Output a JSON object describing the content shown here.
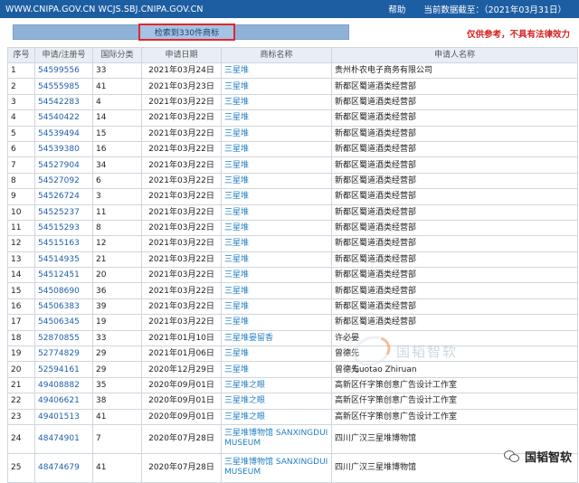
{
  "header": {
    "site": "WWW.CNIPA.GOV.CN WCJS.SBJ.CNIPA.GOV.CN",
    "help": "帮助",
    "date": "当前数据截至：（2021年03月31日）"
  },
  "toolbar": {
    "result": "检索到330件商标",
    "disclaimer": "仅供参考，不具有法律效力"
  },
  "columns": [
    "序号",
    "申请/注册号",
    "国际分类",
    "申请日期",
    "商标名称",
    "申请人名称"
  ],
  "rows": [
    {
      "idx": "1",
      "num": "54599556",
      "cls": "33",
      "date": "2021年03月24日",
      "mark": "三星堆",
      "applicant": "贵州朴农电子商务有限公司"
    },
    {
      "idx": "2",
      "num": "54555985",
      "cls": "41",
      "date": "2021年03月23日",
      "mark": "三星堆",
      "applicant": "新都区蜀道酒类经营部"
    },
    {
      "idx": "3",
      "num": "54542283",
      "cls": "4",
      "date": "2021年03月22日",
      "mark": "三星堆",
      "applicant": "新都区蜀道酒类经营部"
    },
    {
      "idx": "4",
      "num": "54540422",
      "cls": "14",
      "date": "2021年03月22日",
      "mark": "三星堆",
      "applicant": "新都区蜀道酒类经营部"
    },
    {
      "idx": "5",
      "num": "54539494",
      "cls": "15",
      "date": "2021年03月22日",
      "mark": "三星堆",
      "applicant": "新都区蜀道酒类经营部"
    },
    {
      "idx": "6",
      "num": "54539380",
      "cls": "16",
      "date": "2021年03月22日",
      "mark": "三星堆",
      "applicant": "新都区蜀道酒类经营部"
    },
    {
      "idx": "7",
      "num": "54527904",
      "cls": "34",
      "date": "2021年03月22日",
      "mark": "三星堆",
      "applicant": "新都区蜀道酒类经营部"
    },
    {
      "idx": "8",
      "num": "54527092",
      "cls": "6",
      "date": "2021年03月22日",
      "mark": "三星堆",
      "applicant": "新都区蜀道酒类经营部"
    },
    {
      "idx": "9",
      "num": "54526724",
      "cls": "3",
      "date": "2021年03月22日",
      "mark": "三星堆",
      "applicant": "新都区蜀道酒类经营部"
    },
    {
      "idx": "10",
      "num": "54525237",
      "cls": "11",
      "date": "2021年03月22日",
      "mark": "三星堆",
      "applicant": "新都区蜀道酒类经营部"
    },
    {
      "idx": "11",
      "num": "54515293",
      "cls": "8",
      "date": "2021年03月22日",
      "mark": "三星堆",
      "applicant": "新都区蜀道酒类经营部"
    },
    {
      "idx": "12",
      "num": "54515163",
      "cls": "12",
      "date": "2021年03月22日",
      "mark": "三星堆",
      "applicant": "新都区蜀道酒类经营部"
    },
    {
      "idx": "13",
      "num": "54514935",
      "cls": "21",
      "date": "2021年03月22日",
      "mark": "三星堆",
      "applicant": "新都区蜀道酒类经营部"
    },
    {
      "idx": "14",
      "num": "54512451",
      "cls": "20",
      "date": "2021年03月22日",
      "mark": "三星堆",
      "applicant": "新都区蜀道酒类经营部"
    },
    {
      "idx": "15",
      "num": "54508690",
      "cls": "36",
      "date": "2021年03月22日",
      "mark": "三星堆",
      "applicant": "新都区蜀道酒类经营部"
    },
    {
      "idx": "16",
      "num": "54506383",
      "cls": "39",
      "date": "2021年03月22日",
      "mark": "三星堆",
      "applicant": "新都区蜀道酒类经营部"
    },
    {
      "idx": "17",
      "num": "54506345",
      "cls": "19",
      "date": "2021年03月22日",
      "mark": "三星堆",
      "applicant": "新都区蜀道酒类经营部"
    },
    {
      "idx": "18",
      "num": "52870855",
      "cls": "33",
      "date": "2021年01月10日",
      "mark": "三星堆晏留香",
      "applicant": "许必晏"
    },
    {
      "idx": "19",
      "num": "52774829",
      "cls": "29",
      "date": "2021年01月06日",
      "mark": "三星堆",
      "applicant": "曾德先"
    },
    {
      "idx": "20",
      "num": "52594161",
      "cls": "29",
      "date": "2020年12月29日",
      "mark": "三星堆",
      "applicant": "曾德先"
    },
    {
      "idx": "21",
      "num": "49408882",
      "cls": "35",
      "date": "2020年09月01日",
      "mark": "三星堆之眼",
      "applicant": "高新区仟字策创意广告设计工作室"
    },
    {
      "idx": "22",
      "num": "49406621",
      "cls": "38",
      "date": "2020年09月01日",
      "mark": "三星堆之眼",
      "applicant": "高新区仟字策创意广告设计工作室"
    },
    {
      "idx": "23",
      "num": "49401513",
      "cls": "41",
      "date": "2020年09月01日",
      "mark": "三星堆之眼",
      "applicant": "高新区仟字策创意广告设计工作室"
    },
    {
      "idx": "24",
      "num": "48474901",
      "cls": "7",
      "date": "2020年07月28日",
      "mark": "三星堆博物馆 SANXINGDUI MUSEUM",
      "applicant": "四川广汉三星堆博物馆"
    },
    {
      "idx": "25",
      "num": "48474679",
      "cls": "41",
      "date": "2020年07月28日",
      "mark": "三星堆博物馆 SANXINGDUI MUSEUM",
      "applicant": "四川广汉三星堆博物馆"
    }
  ],
  "watermark": {
    "cn": "国韬智软",
    "en": "Guotao Zhiruan"
  },
  "badge": {
    "label": "国韬智软",
    "icon": "wechat-icon"
  }
}
